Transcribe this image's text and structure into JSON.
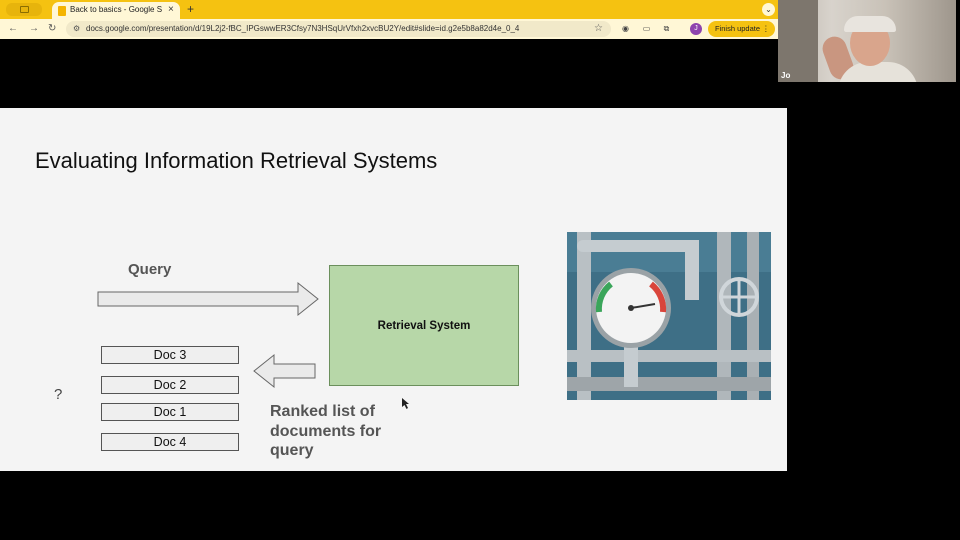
{
  "browser": {
    "tab_title": "Back to basics - Google Slides",
    "new_tab": "+",
    "tab_close": "×",
    "url": "docs.google.com/presentation/d/19L2j2-fBC_IPGswwER3Cfsy7N3HSqUrVfxh2xvcBU2Y/edit#slide=id.g2e5b8a82d4e_0_4",
    "profile_initial": "J",
    "finish_update_label": "Finish update",
    "icons": [
      "back-icon",
      "forward-icon",
      "reload-icon",
      "site-info-icon",
      "bookmark-star-icon",
      "extension-icon",
      "menu-icon"
    ]
  },
  "webcam": {
    "participant_label": "Jo"
  },
  "slide": {
    "title": "Evaluating Information Retrieval Systems",
    "query_label": "Query",
    "retrieval_system_label": "Retrieval System",
    "docs": [
      "Doc 3",
      "Doc 2",
      "Doc 1",
      "Doc 4"
    ],
    "question_mark": "?",
    "ranked_list_label": "Ranked list of documents for query",
    "image_description_icon": "pressure-gauge-pipes-image"
  },
  "colors": {
    "tabbar": "#f5c211",
    "toolbar": "#fff7d6",
    "retrieval_box": "#b7d7a8",
    "slide_bg": "#f4f4f4"
  }
}
